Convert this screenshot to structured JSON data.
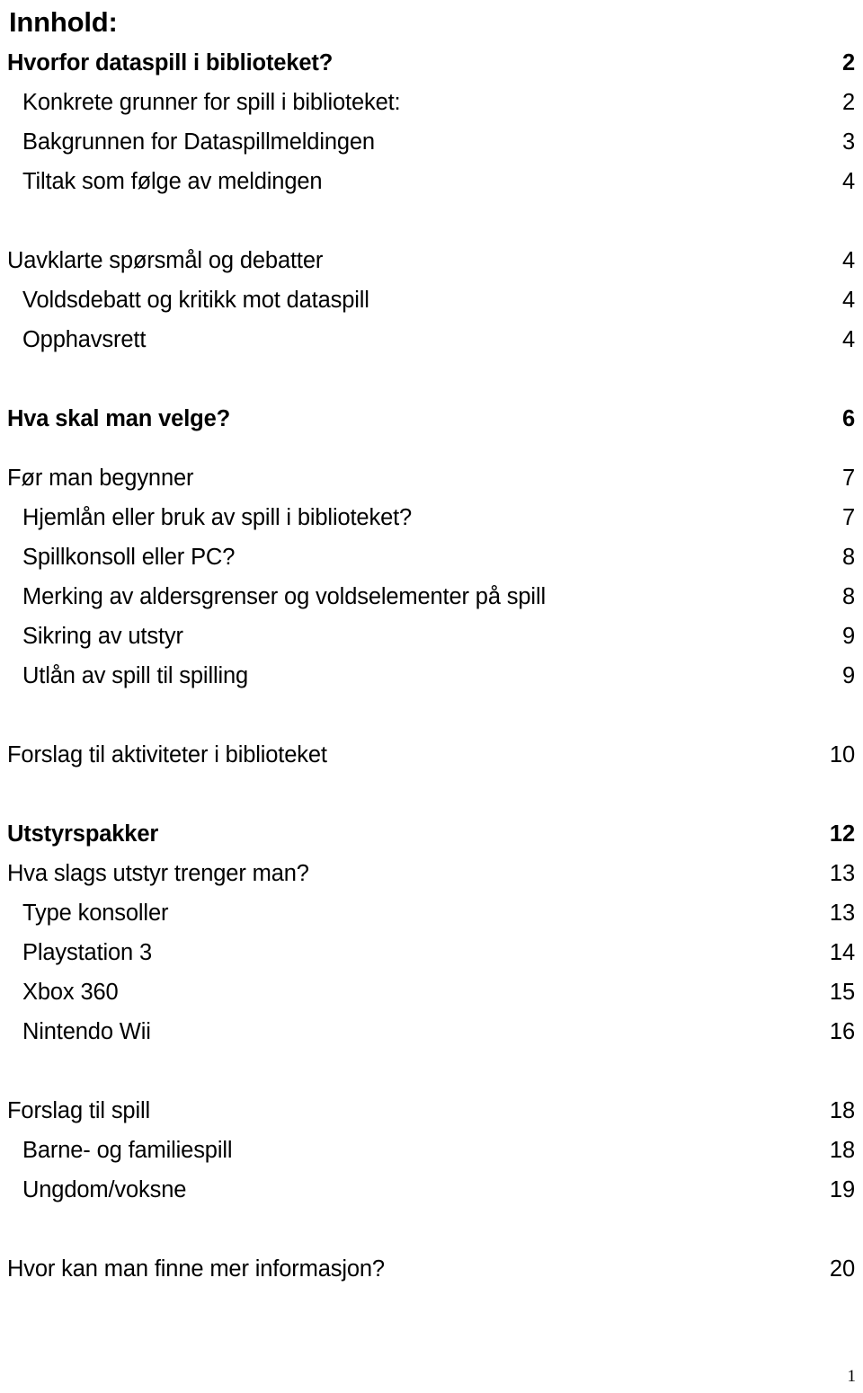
{
  "document": {
    "heading": "Innhold:",
    "footer_page_number": "1"
  },
  "toc": {
    "entries": [
      {
        "id": "hvorfor-dataspill",
        "title": "Hvorfor dataspill i biblioteket?",
        "page": "2",
        "level": 0,
        "bold": true
      },
      {
        "id": "konkrete-grunner",
        "title": "Konkrete grunner for spill i biblioteket:",
        "page": "2",
        "level": 1,
        "bold": false
      },
      {
        "id": "bakgrunnen",
        "title": "Bakgrunnen for Dataspillmeldingen",
        "page": "3",
        "level": 1,
        "bold": false
      },
      {
        "id": "tiltak",
        "title": "Tiltak som følge av meldingen",
        "page": "4",
        "level": 1,
        "bold": false
      },
      {
        "id": "uavklarte",
        "title": "Uavklarte spørsmål og debatter",
        "page": "4",
        "level": 0,
        "bold": false
      },
      {
        "id": "voldsdebatt",
        "title": "Voldsdebatt og kritikk mot dataspill",
        "page": "4",
        "level": 1,
        "bold": false
      },
      {
        "id": "opphavsrett",
        "title": "Opphavsrett",
        "page": "4",
        "level": 1,
        "bold": false
      },
      {
        "id": "hva-skal-man-velge",
        "title": "Hva skal man velge?",
        "page": "6",
        "level": 0,
        "bold": true
      },
      {
        "id": "for-man-begynner",
        "title": "Før man begynner",
        "page": "7",
        "level": 0,
        "bold": false
      },
      {
        "id": "hjemlan",
        "title": "Hjemlån eller bruk av spill i biblioteket?",
        "page": "7",
        "level": 1,
        "bold": false
      },
      {
        "id": "spillkonsoll-eller-pc",
        "title": "Spillkonsoll eller PC?",
        "page": "8",
        "level": 1,
        "bold": false
      },
      {
        "id": "merking",
        "title": "Merking av aldersgrenser og voldselementer på spill",
        "page": "8",
        "level": 1,
        "bold": false
      },
      {
        "id": "sikring",
        "title": "Sikring av utstyr",
        "page": "9",
        "level": 1,
        "bold": false
      },
      {
        "id": "utlan",
        "title": "Utlån av spill til spilling",
        "page": "9",
        "level": 1,
        "bold": false
      },
      {
        "id": "forslag-aktiviteter",
        "title": "Forslag til aktiviteter i biblioteket",
        "page": "10",
        "level": 0,
        "bold": false
      },
      {
        "id": "utstyrspakker",
        "title": "Utstyrspakker",
        "page": "12",
        "level": 0,
        "bold": true
      },
      {
        "id": "hva-slags-utstyr",
        "title": "Hva slags utstyr trenger man?",
        "page": "13",
        "level": 0,
        "bold": false
      },
      {
        "id": "type-konsoller",
        "title": "Type konsoller",
        "page": "13",
        "level": 1,
        "bold": false
      },
      {
        "id": "playstation-3",
        "title": "Playstation 3",
        "page": "14",
        "level": 1,
        "bold": false
      },
      {
        "id": "xbox-360",
        "title": "Xbox 360",
        "page": "15",
        "level": 1,
        "bold": false
      },
      {
        "id": "nintendo-wii",
        "title": "Nintendo Wii",
        "page": "16",
        "level": 1,
        "bold": false
      },
      {
        "id": "forslag-til-spill",
        "title": "Forslag til spill",
        "page": "18",
        "level": 0,
        "bold": false
      },
      {
        "id": "barne-familiespill",
        "title": "Barne- og familiespill",
        "page": "18",
        "level": 1,
        "bold": false
      },
      {
        "id": "ungdom-voksne",
        "title": "Ungdom/voksne",
        "page": "19",
        "level": 1,
        "bold": false
      },
      {
        "id": "hvor-finne-info",
        "title": "Hvor kan man finne mer informasjon?",
        "page": "20",
        "level": 0,
        "bold": false
      }
    ],
    "gaps_after": [
      "tiltak",
      "opphavsrett",
      "utlan",
      "forslag-aktiviteter",
      "nintendo-wii",
      "ungdom-voksne"
    ],
    "small_gap_after": [
      "hva-skal-man-velge"
    ]
  }
}
